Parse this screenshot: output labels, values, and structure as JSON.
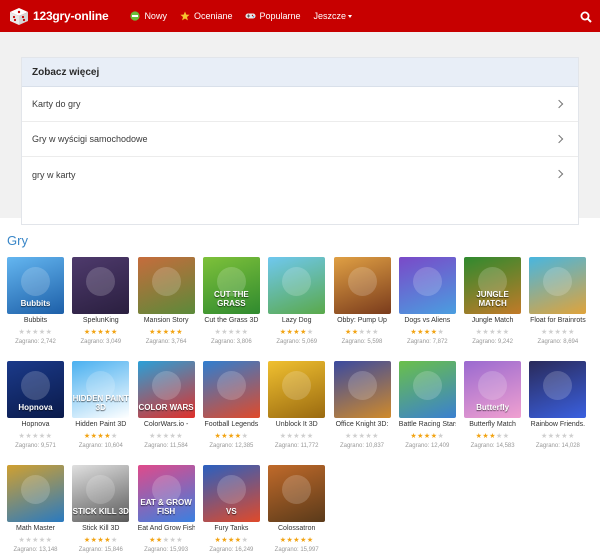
{
  "header": {
    "logo_text": "123gry-online",
    "nav": [
      {
        "label": "Nowy",
        "icon": "new-badge-icon"
      },
      {
        "label": "Oceniane",
        "icon": "star-icon"
      },
      {
        "label": "Popularne",
        "icon": "gamepad-icon"
      },
      {
        "label": "Jeszcze",
        "icon": "chevron-down-icon"
      }
    ],
    "brand_color": "#c70000"
  },
  "panel": {
    "title": "Zobacz więcej",
    "items": [
      {
        "label": "Karty do gry"
      },
      {
        "label": "Gry w wyścigi samochodowe"
      },
      {
        "label": "gry w karty"
      }
    ]
  },
  "games": {
    "title": "Gry",
    "items": [
      {
        "title": "Bubbits",
        "rating": 0,
        "plays": "Zagrano: 2,742",
        "thumb_text": "Bubbits",
        "colors": [
          "#64b6f0",
          "#1d5fa8"
        ]
      },
      {
        "title": "SpelunKing",
        "rating": 5,
        "plays": "Zagrano: 3,049",
        "thumb_text": "",
        "colors": [
          "#4e3a6c",
          "#2a1f3f"
        ]
      },
      {
        "title": "Mansion Story",
        "rating": 5,
        "plays": "Zagrano: 3,764",
        "thumb_text": "",
        "colors": [
          "#c66c3c",
          "#5b8a3a"
        ]
      },
      {
        "title": "Cut the Grass 3D",
        "rating": 0,
        "plays": "Zagrano: 3,806",
        "thumb_text": "CUT THE GRASS",
        "colors": [
          "#7ec13a",
          "#2f8a2f"
        ]
      },
      {
        "title": "Lazy Dog",
        "rating": 4,
        "plays": "Zagrano: 5,069",
        "thumb_text": "",
        "colors": [
          "#6fc8f0",
          "#5aa94a"
        ]
      },
      {
        "title": "Obby: Pump Up",
        "rating": 2,
        "plays": "Zagrano: 5,598",
        "thumb_text": "",
        "colors": [
          "#e0a044",
          "#7a3b1c"
        ]
      },
      {
        "title": "Dogs vs Aliens",
        "rating": 4,
        "plays": "Zagrano: 7,872",
        "thumb_text": "",
        "colors": [
          "#7a49c8",
          "#4a9ee0"
        ]
      },
      {
        "title": "Jungle Match",
        "rating": 0,
        "plays": "Zagrano: 9,242",
        "thumb_text": "JUNGLE MATCH",
        "colors": [
          "#2f8a2f",
          "#c27a28"
        ]
      },
      {
        "title": "Float for Brainrots",
        "rating": 0,
        "plays": "Zagrano: 8,694",
        "thumb_text": "",
        "colors": [
          "#48b6e0",
          "#e0a33a"
        ]
      },
      {
        "title": "Hopnova",
        "rating": 0,
        "plays": "Zagrano: 9,571",
        "thumb_text": "Hopnova",
        "colors": [
          "#1b3a8a",
          "#0a1a4a"
        ]
      },
      {
        "title": "Hidden Paint 3D",
        "rating": 4,
        "plays": "Zagrano: 10,604",
        "thumb_text": "HIDDEN PAINT 3D",
        "colors": [
          "#4ab0f0",
          "#ffffff"
        ]
      },
      {
        "title": "ColorWars.io -",
        "rating": 0,
        "plays": "Zagrano: 11,584",
        "thumb_text": "COLOR WARS",
        "colors": [
          "#2aa0d8",
          "#e0302a"
        ]
      },
      {
        "title": "Football Legends",
        "rating": 4,
        "plays": "Zagrano: 12,385",
        "thumb_text": "",
        "colors": [
          "#2f7ed0",
          "#e04a2a"
        ]
      },
      {
        "title": "Unblock It 3D",
        "rating": 0,
        "plays": "Zagrano: 11,772",
        "thumb_text": "",
        "colors": [
          "#f0c030",
          "#9a6a10"
        ]
      },
      {
        "title": "Office Knight 3D:",
        "rating": 0,
        "plays": "Zagrano: 10,837",
        "thumb_text": "",
        "colors": [
          "#3a4aa0",
          "#d08a2a"
        ]
      },
      {
        "title": "Battle Racing Stars",
        "rating": 4,
        "plays": "Zagrano: 12,409",
        "thumb_text": "",
        "colors": [
          "#6ac04a",
          "#3a80d0"
        ]
      },
      {
        "title": "Butterfly Match",
        "rating": 3,
        "plays": "Zagrano: 14,583",
        "thumb_text": "Butterfly",
        "colors": [
          "#9a6ad0",
          "#f0a0d0"
        ]
      },
      {
        "title": "Rainbow Friends.",
        "rating": 0,
        "plays": "Zagrano: 14,028",
        "thumb_text": "",
        "colors": [
          "#2a2a5a",
          "#3a60e0"
        ]
      },
      {
        "title": "Math Master",
        "rating": 0,
        "plays": "Zagrano: 13,148",
        "thumb_text": "",
        "colors": [
          "#d0a030",
          "#2a7ac0"
        ]
      },
      {
        "title": "Stick Kill 3D",
        "rating": 4,
        "plays": "Zagrano: 15,846",
        "thumb_text": "STICK KILL 3D",
        "colors": [
          "#e0e0e0",
          "#5a5a5a"
        ]
      },
      {
        "title": "Eat And Grow Fish",
        "rating": 2,
        "plays": "Zagrano: 15,993",
        "thumb_text": "EAT & GROW FISH",
        "colors": [
          "#e04a8a",
          "#3a80e0"
        ]
      },
      {
        "title": "Fury Tanks",
        "rating": 4,
        "plays": "Zagrano: 16,249",
        "thumb_text": "VS",
        "colors": [
          "#2a60c0",
          "#e04a2a"
        ]
      },
      {
        "title": "Colossatron",
        "rating": 5,
        "plays": "Zagrano: 15,997",
        "thumb_text": "",
        "colors": [
          "#c06a2a",
          "#5a3a1a"
        ]
      }
    ]
  }
}
